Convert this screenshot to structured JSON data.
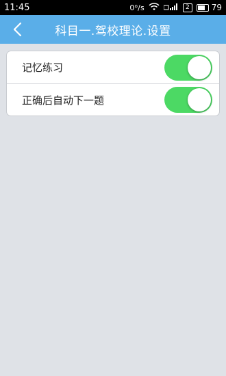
{
  "status_bar": {
    "time": "11:45",
    "net_speed": "0⁰/s",
    "sim_slot": "2",
    "battery_level": "79",
    "battery_fraction": 0.79
  },
  "nav": {
    "back_icon": "chevron-left-icon",
    "title": "科目一.驾校理论.设置"
  },
  "settings": {
    "items": [
      {
        "label": "记忆练习",
        "enabled": true
      },
      {
        "label": "正确后自动下一题",
        "enabled": true
      }
    ]
  },
  "colors": {
    "nav_bar": "#5aaee8",
    "toggle_on": "#4cd964",
    "background": "#dfe2e7"
  }
}
